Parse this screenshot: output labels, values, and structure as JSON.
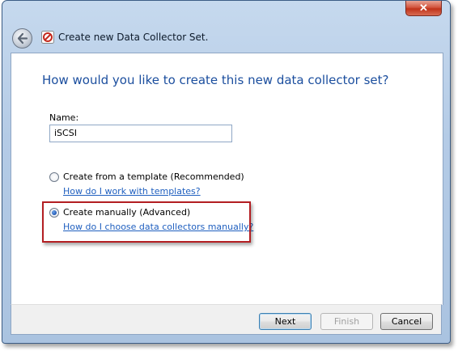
{
  "window": {
    "title": "Create new Data Collector Set.",
    "close_label": "✕"
  },
  "content": {
    "heading": "How would you like to create this new data collector set?",
    "name_label": "Name:",
    "name_value": "iSCSI",
    "options": [
      {
        "label": "Create from a template (Recommended)",
        "link": "How do I work with templates?",
        "selected": false
      },
      {
        "label": "Create manually (Advanced)",
        "link": "How do I choose data collectors manually?",
        "selected": true
      }
    ]
  },
  "footer": {
    "next_label": "Next",
    "finish_label": "Finish",
    "cancel_label": "Cancel"
  },
  "colors": {
    "heading": "#1b4e9e",
    "link": "#1f5fbf",
    "highlight": "#b31e22"
  }
}
